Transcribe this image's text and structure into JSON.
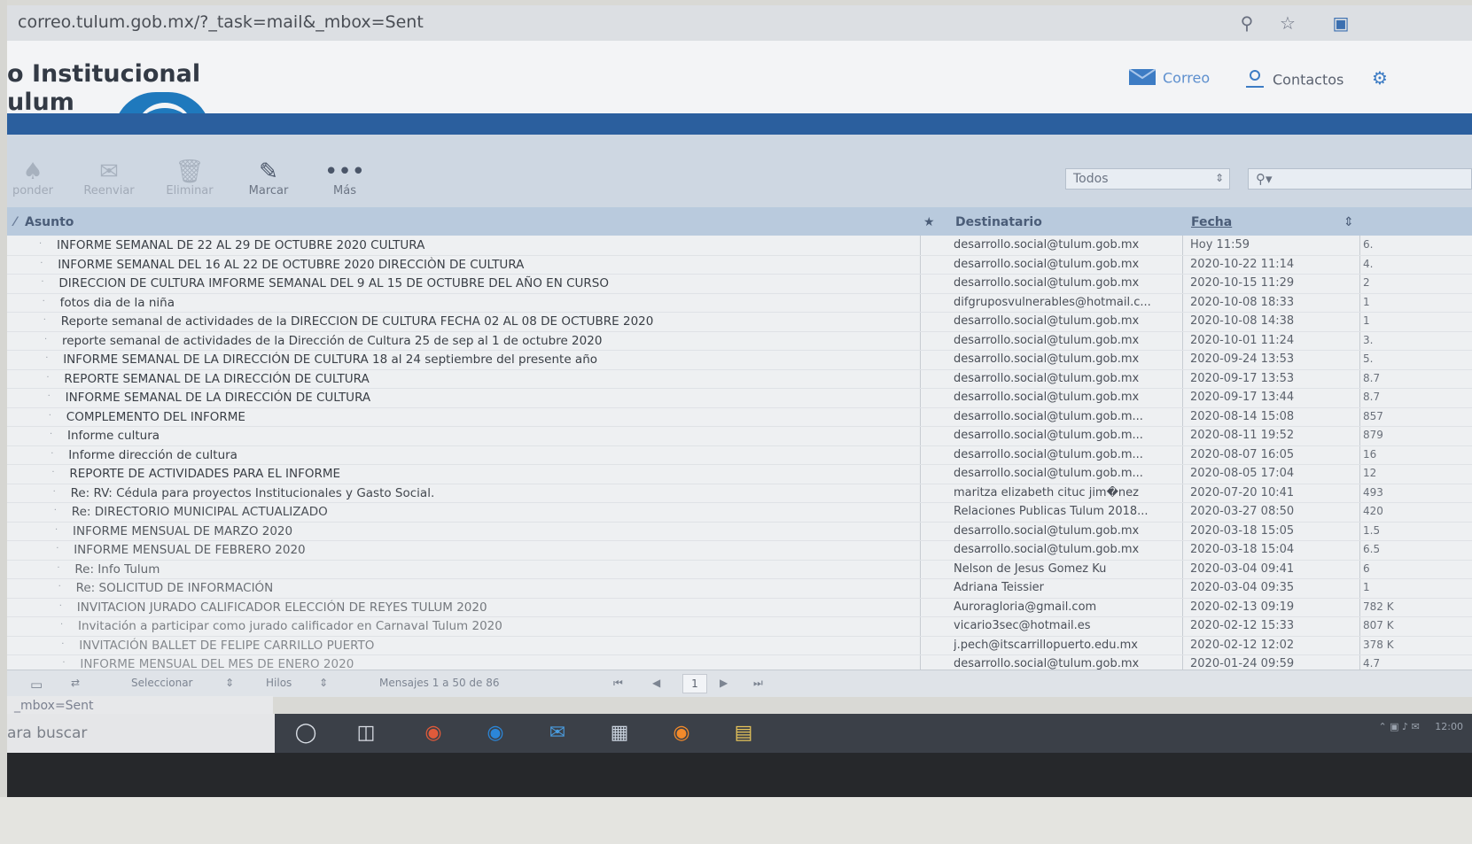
{
  "browser": {
    "url": "correo.tulum.gob.mx/?_task=mail&_mbox=Sent"
  },
  "header": {
    "brand_line1": "o Institucional",
    "brand_line2": "ulum",
    "nav": [
      {
        "label": "Correo",
        "icon": "mail-icon"
      },
      {
        "label": "Contactos",
        "icon": "contacts-icon"
      }
    ]
  },
  "toolbar": {
    "buttons": [
      {
        "label": "ponder",
        "icon": "reply-icon"
      },
      {
        "label": "Reenviar",
        "icon": "forward-icon"
      },
      {
        "label": "Eliminar",
        "icon": "trash-icon"
      },
      {
        "label": "Marcar",
        "icon": "pen-icon"
      },
      {
        "label": "Más",
        "icon": "more-icon"
      }
    ],
    "filter": "Todos",
    "search_placeholder": ""
  },
  "list": {
    "columns": {
      "subject": "Asunto",
      "recipient": "Destinatario",
      "date": "Fecha"
    },
    "rows": [
      {
        "subject": "INFORME SEMANAL DE 22 AL 29 DE OCTUBRE 2020 CULTURA",
        "to": "desarrollo.social@tulum.gob.mx",
        "date": "Hoy 11:59",
        "size": "6."
      },
      {
        "subject": "INFORME SEMANAL DEL 16 AL 22 DE OCTUBRE 2020 DIRECCIÒN DE CULTURA",
        "to": "desarrollo.social@tulum.gob.mx",
        "date": "2020-10-22 11:14",
        "size": "4."
      },
      {
        "subject": "DIRECCION DE CULTURA IMFORME SEMANAL DEL 9 AL 15 DE OCTUBRE DEL AÑO EN CURSO",
        "to": "desarrollo.social@tulum.gob.mx",
        "date": "2020-10-15 11:29",
        "size": "2"
      },
      {
        "subject": "fotos dia de la niña",
        "to": "difgruposvulnerables@hotmail.c...",
        "date": "2020-10-08 18:33",
        "size": "1"
      },
      {
        "subject": "Reporte semanal de actividades de la DIRECCION DE CULTURA FECHA 02 AL 08 DE OCTUBRE 2020",
        "to": "desarrollo.social@tulum.gob.mx",
        "date": "2020-10-08 14:38",
        "size": "1"
      },
      {
        "subject": "reporte semanal de actividades de la Dirección de Cultura 25 de sep al 1 de octubre 2020",
        "to": "desarrollo.social@tulum.gob.mx",
        "date": "2020-10-01 11:24",
        "size": "3."
      },
      {
        "subject": "INFORME SEMANAL DE LA DIRECCIÓN DE CULTURA 18 al 24 septiembre del presente año",
        "to": "desarrollo.social@tulum.gob.mx",
        "date": "2020-09-24 13:53",
        "size": "5."
      },
      {
        "subject": "REPORTE SEMANAL DE LA DIRECCIÓN DE CULTURA",
        "to": "desarrollo.social@tulum.gob.mx",
        "date": "2020-09-17 13:53",
        "size": "8.7"
      },
      {
        "subject": "INFORME SEMANAL DE LA DIRECCIÓN DE CULTURA",
        "to": "desarrollo.social@tulum.gob.mx",
        "date": "2020-09-17 13:44",
        "size": "8.7"
      },
      {
        "subject": "COMPLEMENTO DEL INFORME",
        "to": "desarrollo.social@tulum.gob.m...",
        "date": "2020-08-14 15:08",
        "size": "857"
      },
      {
        "subject": "Informe cultura",
        "to": "desarrollo.social@tulum.gob.m...",
        "date": "2020-08-11 19:52",
        "size": "879"
      },
      {
        "subject": "Informe dirección de cultura",
        "to": "desarrollo.social@tulum.gob.m...",
        "date": "2020-08-07 16:05",
        "size": "16"
      },
      {
        "subject": "REPORTE DE ACTIVIDADES PARA EL INFORME",
        "to": "desarrollo.social@tulum.gob.m...",
        "date": "2020-08-05 17:04",
        "size": "12"
      },
      {
        "subject": "Re: RV: Cédula para proyectos Institucionales y Gasto Social.",
        "to": "maritza elizabeth cituc jim�nez",
        "date": "2020-07-20 10:41",
        "size": "493"
      },
      {
        "subject": "Re: DIRECTORIO MUNICIPAL ACTUALIZADO",
        "to": "Relaciones Publicas Tulum 2018...",
        "date": "2020-03-27 08:50",
        "size": "420"
      },
      {
        "subject": "INFORME MENSUAL DE MARZO 2020",
        "to": "desarrollo.social@tulum.gob.mx",
        "date": "2020-03-18 15:05",
        "size": "1.5"
      },
      {
        "subject": "INFORME MENSUAL DE FEBRERO 2020",
        "to": "desarrollo.social@tulum.gob.mx",
        "date": "2020-03-18 15:04",
        "size": "6.5"
      },
      {
        "subject": "Re: Info Tulum",
        "to": "Nelson de Jesus Gomez Ku",
        "date": "2020-03-04 09:41",
        "size": "6"
      },
      {
        "subject": "Re: SOLICITUD DE INFORMACIÓN",
        "to": "Adriana Teissier",
        "date": "2020-03-04 09:35",
        "size": "1"
      },
      {
        "subject": "INVITACION JURADO CALIFICADOR ELECCIÓN DE REYES TULUM 2020",
        "to": "Auroragloria@gmail.com",
        "date": "2020-02-13 09:19",
        "size": "782 K"
      },
      {
        "subject": "Invitación a participar como jurado calificador en Carnaval Tulum 2020",
        "to": "vicario3sec@hotmail.es",
        "date": "2020-02-12 15:33",
        "size": "807 K"
      },
      {
        "subject": "INVITACIÓN BALLET DE FELIPE CARRILLO PUERTO",
        "to": "j.pech@itscarrillopuerto.edu.mx",
        "date": "2020-02-12 12:02",
        "size": "378 K"
      },
      {
        "subject": "INFORME MENSUAL DEL MES DE ENERO 2020",
        "to": "desarrollo.social@tulum.gob.mx",
        "date": "2020-01-24 09:59",
        "size": "4.7"
      }
    ]
  },
  "footer": {
    "select_label": "Seleccionar",
    "threads_label": "Hilos",
    "count_text": "Mensajes 1 a 50 de 86",
    "page": "1"
  },
  "status": {
    "url_hint": "_mbox=Sent",
    "search_hint": "ara buscar"
  },
  "tray": {
    "time": "12:00"
  }
}
